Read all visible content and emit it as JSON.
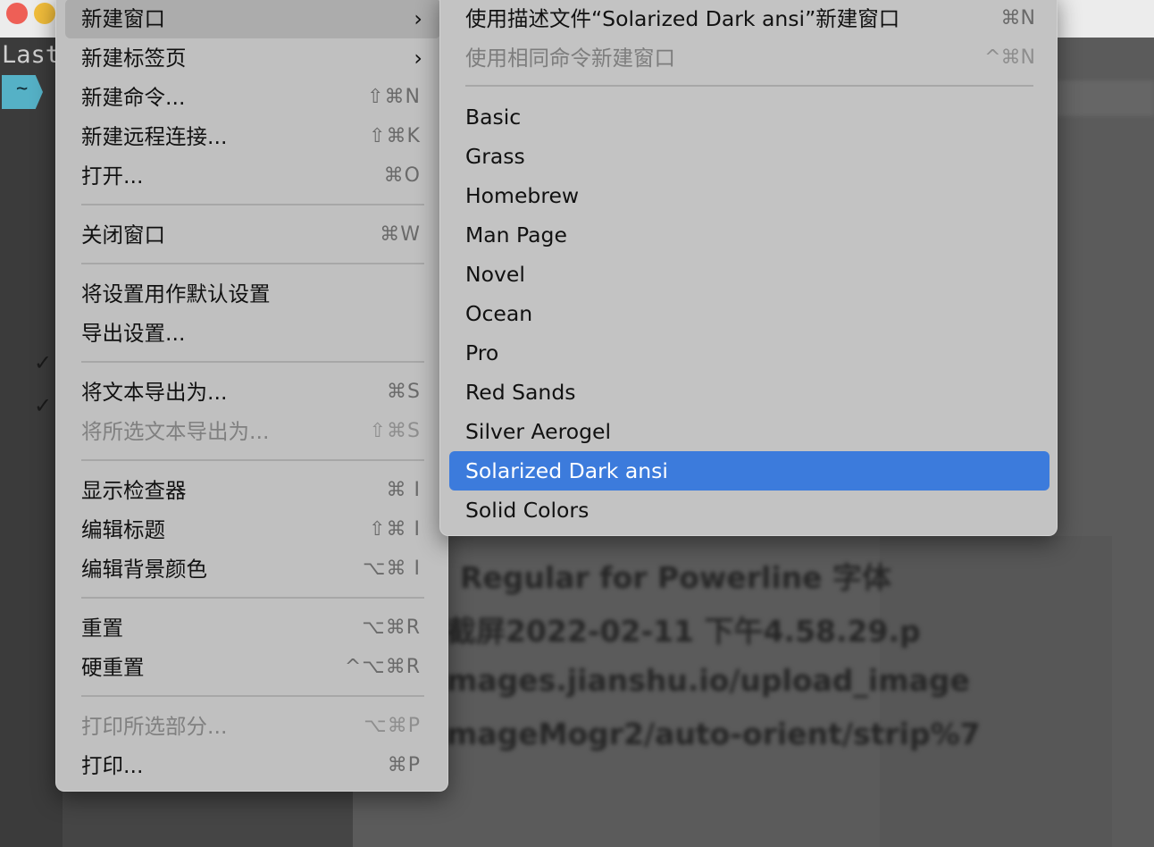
{
  "menu": {
    "items": [
      {
        "label": "新建窗口",
        "shortcut": "",
        "submenu": true,
        "highlighted": true
      },
      {
        "label": "新建标签页",
        "shortcut": "",
        "submenu": true
      },
      {
        "label": "新建命令...",
        "shortcut": "⇧⌘N"
      },
      {
        "label": "新建远程连接...",
        "shortcut": "⇧⌘K"
      },
      {
        "label": "打开...",
        "shortcut": "⌘O"
      },
      {
        "label": "关闭窗口",
        "shortcut": "⌘W"
      },
      {
        "label": "将设置用作默认设置",
        "shortcut": ""
      },
      {
        "label": "导出设置...",
        "shortcut": ""
      },
      {
        "label": "将文本导出为...",
        "shortcut": "⌘S"
      },
      {
        "label": "将所选文本导出为...",
        "shortcut": "⇧⌘S",
        "disabled": true
      },
      {
        "label": "显示检查器",
        "shortcut": "⌘ I"
      },
      {
        "label": "编辑标题",
        "shortcut": "⇧⌘ I"
      },
      {
        "label": "编辑背景颜色",
        "shortcut": "⌥⌘ I"
      },
      {
        "label": "重置",
        "shortcut": "⌥⌘R"
      },
      {
        "label": "硬重置",
        "shortcut": "^⌥⌘R"
      },
      {
        "label": "打印所选部分...",
        "shortcut": "⌥⌘P",
        "disabled": true
      },
      {
        "label": "打印...",
        "shortcut": "⌘P"
      }
    ]
  },
  "submenu": {
    "items": [
      {
        "label": "使用描述文件“Solarized Dark ansi”新建窗口",
        "shortcut": "⌘N"
      },
      {
        "label": "使用相同命令新建窗口",
        "shortcut": "^⌘N",
        "disabled": true
      },
      {
        "label": "Basic"
      },
      {
        "label": "Grass"
      },
      {
        "label": "Homebrew"
      },
      {
        "label": "Man Page"
      },
      {
        "label": "Novel"
      },
      {
        "label": "Ocean"
      },
      {
        "label": "Pro"
      },
      {
        "label": "Red Sands"
      },
      {
        "label": "Silver Aerogel"
      },
      {
        "label": "Solarized Dark ansi",
        "selected": true
      },
      {
        "label": "Solid Colors"
      }
    ]
  },
  "background": {
    "terminal_last": "Last",
    "prompt": "~",
    "doc_lines": [
      "Regular for Powerline 字体",
      "截屏2022-02-11 下午4.58.29.p",
      "mages.jianshu.io/upload_image",
      "mageMogr2/auto-orient/strip%7"
    ]
  },
  "colors": {
    "selection": "#3c7bdc",
    "menu_bg": "#c0c0c0",
    "prompt_bg": "#55b1c6"
  }
}
